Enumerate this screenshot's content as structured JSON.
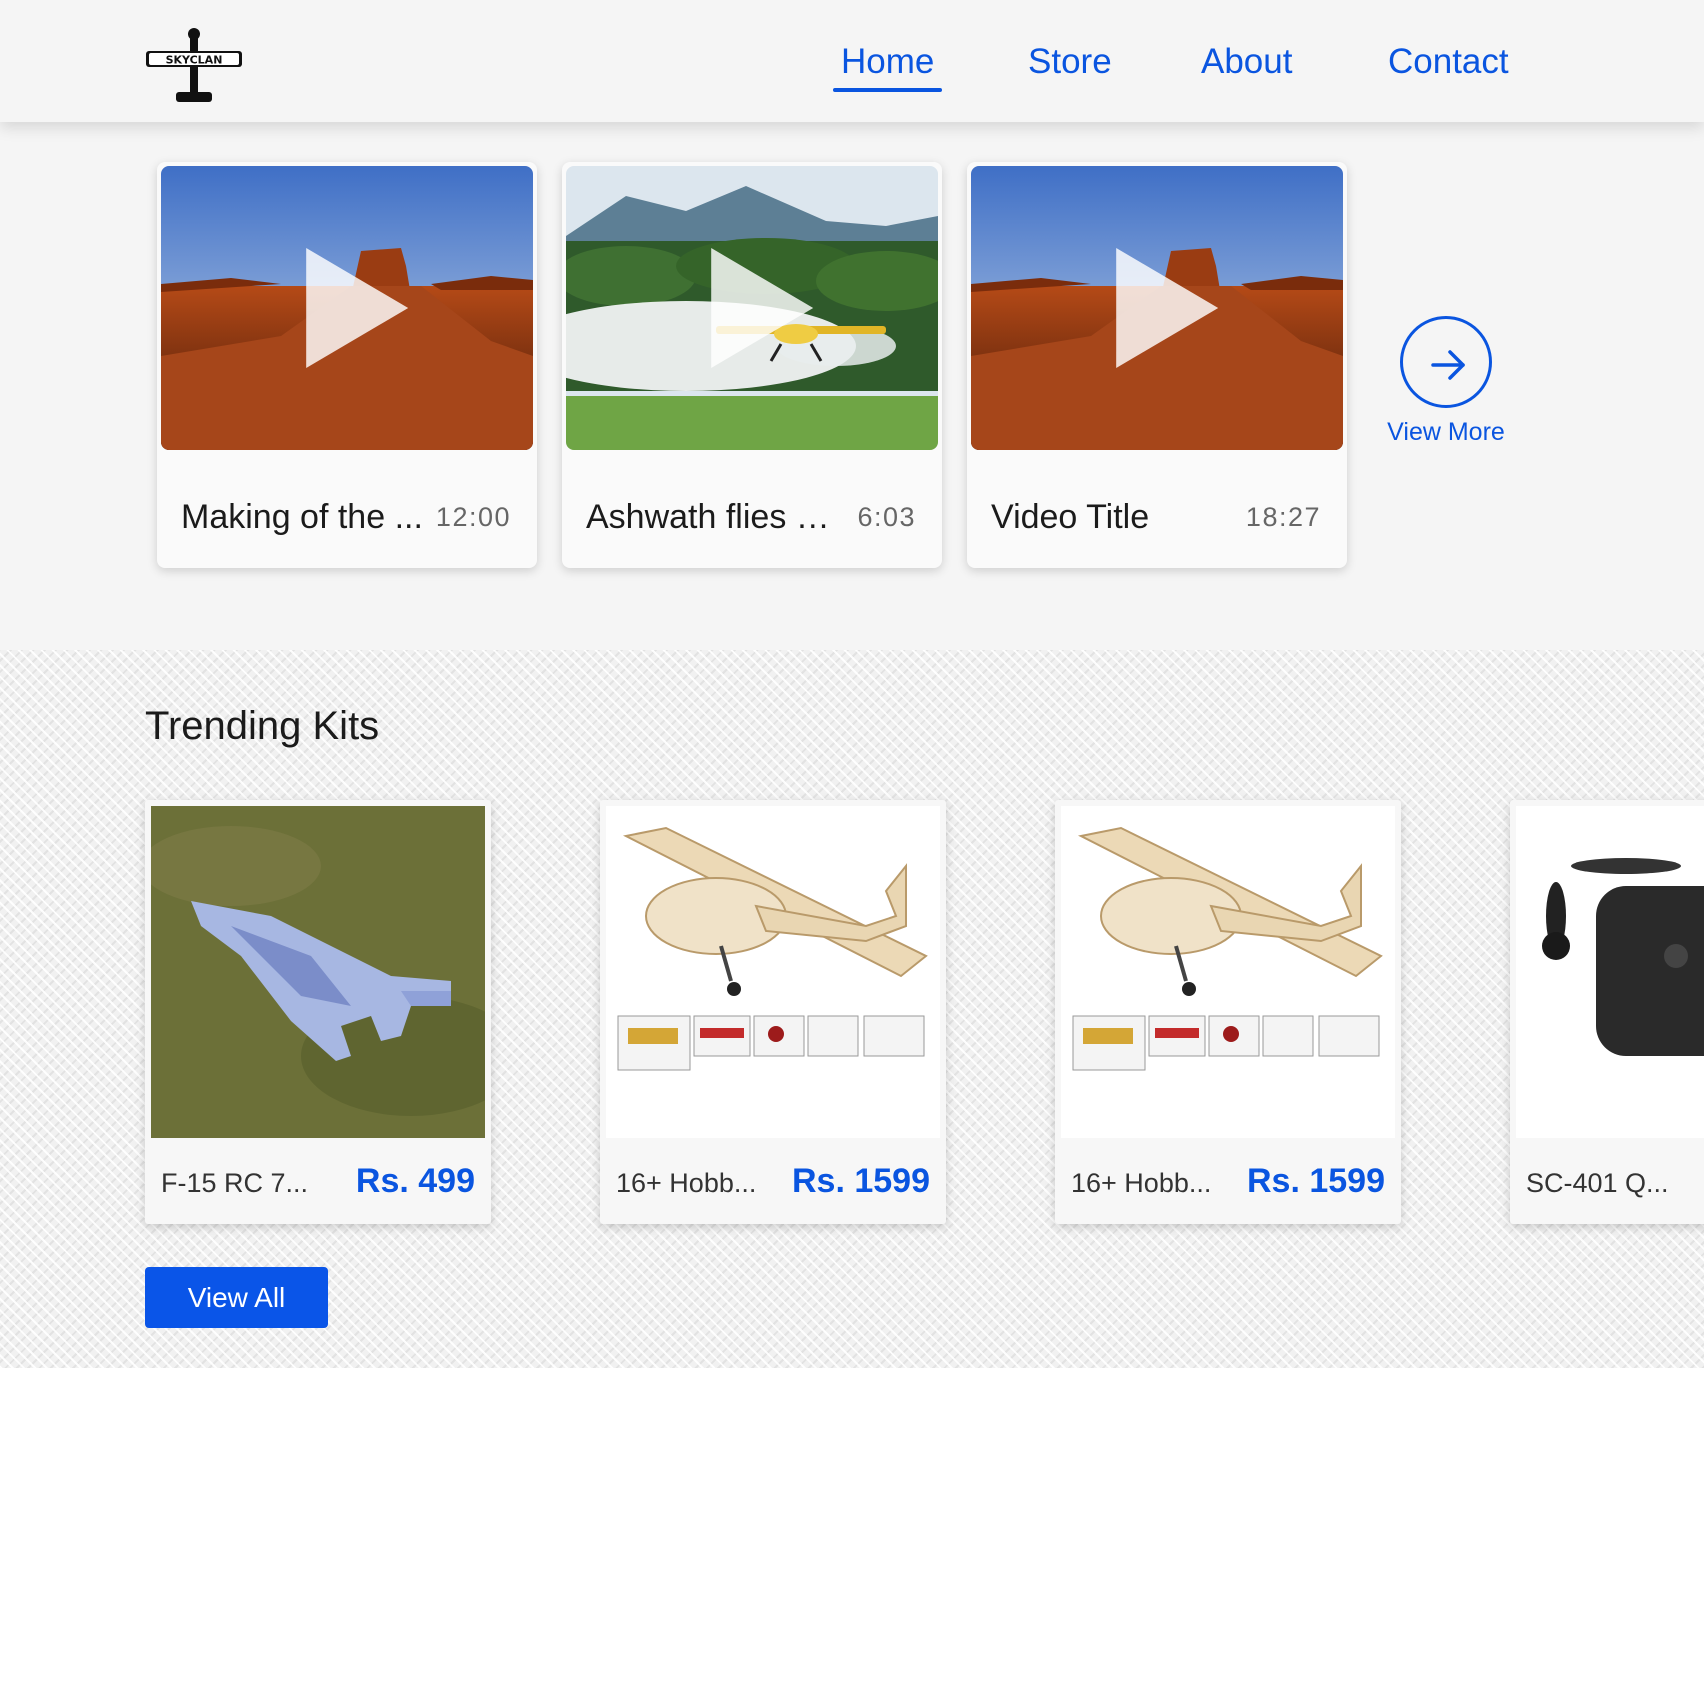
{
  "brand": {
    "logo_text": "SKYCLAN"
  },
  "nav": {
    "items": [
      {
        "label": "Home",
        "active": true
      },
      {
        "label": "Store",
        "active": false
      },
      {
        "label": "About",
        "active": false
      },
      {
        "label": "Contact",
        "active": false
      }
    ]
  },
  "videos": {
    "items": [
      {
        "title": "Making of the ...",
        "duration": "12:00",
        "thumb": "desert-mesa"
      },
      {
        "title": "Ashwath flies a...",
        "duration": "6:03",
        "thumb": "crop-duster-plane"
      },
      {
        "title": "Video Title",
        "duration": "18:27",
        "thumb": "desert-mesa"
      }
    ],
    "view_more_label": "View More"
  },
  "trending": {
    "title": "Trending Kits",
    "items": [
      {
        "name": "F-15 RC 7...",
        "price": "Rs. 499",
        "image": "f15-jet-on-grass"
      },
      {
        "name": "16+ Hobb...",
        "price": "Rs. 1599",
        "image": "balsa-plane-kit"
      },
      {
        "name": "16+ Hobb...",
        "price": "Rs. 1599",
        "image": "balsa-plane-kit"
      },
      {
        "name": "SC-401 Q...",
        "price": "",
        "image": "quadcopter-drone"
      }
    ],
    "view_all_label": "View All"
  },
  "colors": {
    "accent": "#0a55e0",
    "header_bg": "#f5f5f5"
  }
}
